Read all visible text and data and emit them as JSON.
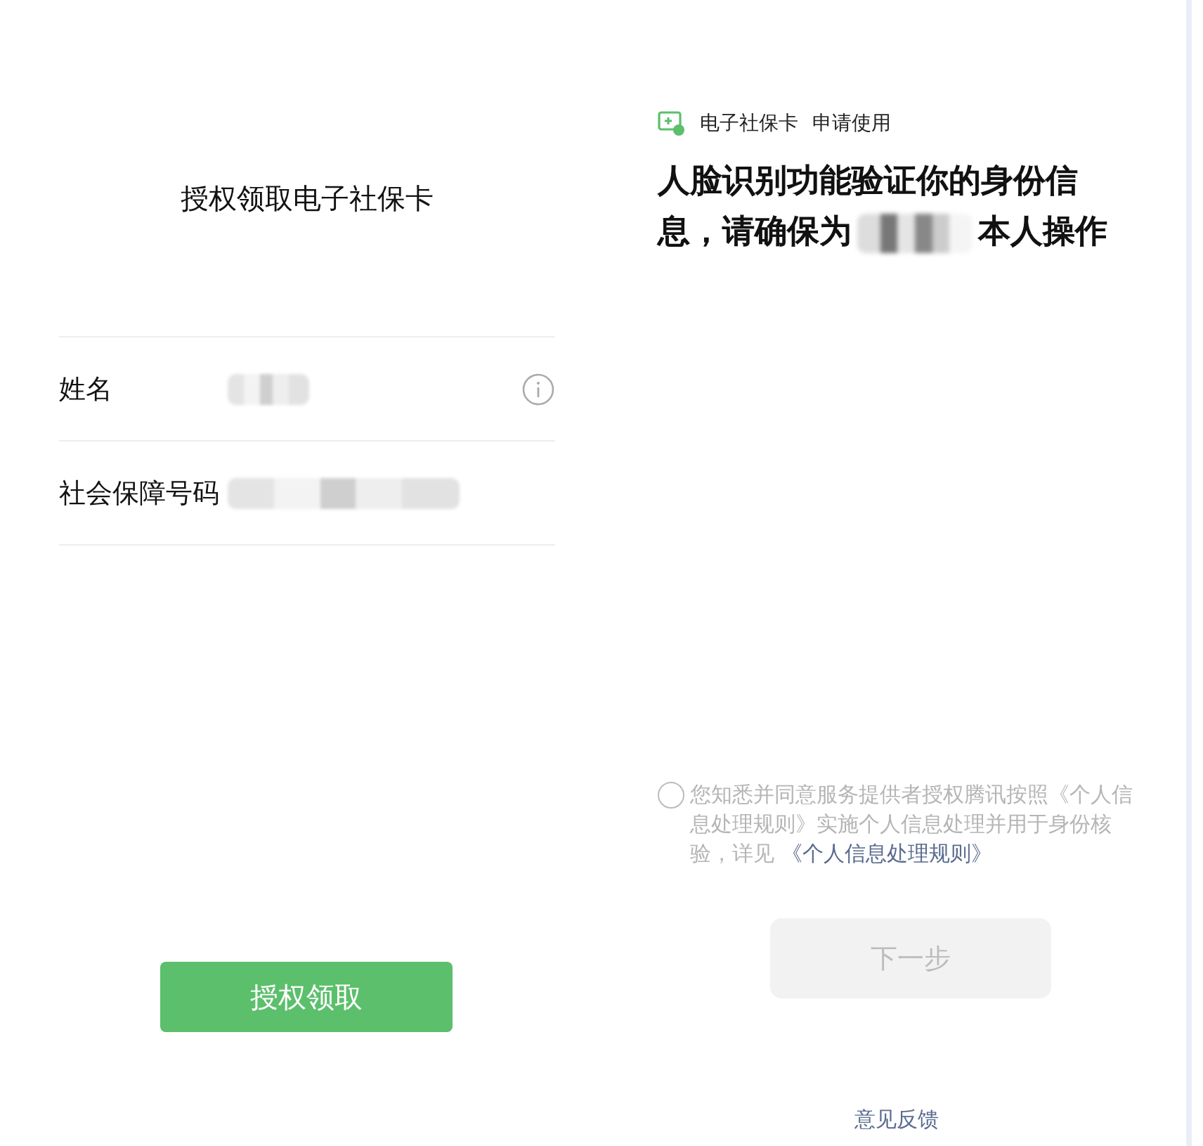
{
  "left_screen": {
    "title": "授权领取电子社保卡",
    "fields": [
      {
        "label": "姓名",
        "redacted": true,
        "info_icon": true
      },
      {
        "label": "社会保障号码",
        "redacted": true,
        "info_icon": false
      }
    ],
    "button": "授权领取"
  },
  "right_screen": {
    "app_name": "电子社保卡",
    "app_action": "申请使用",
    "heading_before": "人脸识别功能验证你的身份信息，请确保为",
    "heading_after": "本人操作",
    "agreement": {
      "checked": false,
      "text": "您知悉并同意服务提供者授权腾讯按照《个人信息处理规则》实施个人信息处理并用于身份核验，详见",
      "link": "《个人信息处理规则》"
    },
    "button": {
      "label": "下一步",
      "disabled": true
    },
    "feedback": "意见反馈"
  }
}
